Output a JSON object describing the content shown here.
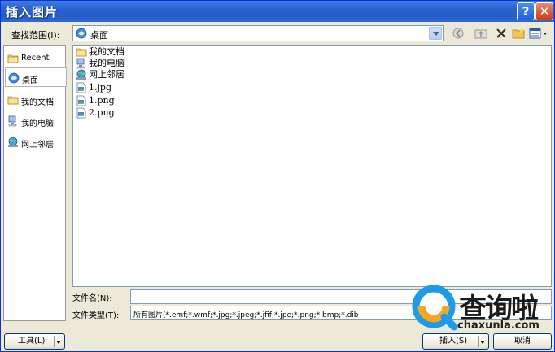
{
  "window": {
    "title": "插入图片"
  },
  "titlebar": {
    "help_glyph": "?",
    "close_glyph": "✕"
  },
  "lookin": {
    "label": "查找范围(I):",
    "value": "桌面"
  },
  "places": [
    {
      "label": "Recent",
      "icon": "folder-icon"
    },
    {
      "label": "桌面",
      "icon": "desktop-icon",
      "selected": true
    },
    {
      "label": "我的文档",
      "icon": "folder-icon"
    },
    {
      "label": "我的电脑",
      "icon": "computer-icon"
    },
    {
      "label": "网上邻居",
      "icon": "network-icon"
    }
  ],
  "files": [
    {
      "name": "我的文档",
      "icon": "folder-icon"
    },
    {
      "name": "我的电脑",
      "icon": "computer-icon"
    },
    {
      "name": "网上邻居",
      "icon": "network-icon"
    },
    {
      "name": "1.jpg",
      "icon": "image-file-icon"
    },
    {
      "name": "1.png",
      "icon": "image-file-icon"
    },
    {
      "name": "2.png",
      "icon": "image-file-icon"
    }
  ],
  "filename": {
    "label": "文件名(N):",
    "value": ""
  },
  "filetype": {
    "label": "文件类型(T):",
    "value": "所有图片(*.emf;*.wmf;*.jpg;*.jpeg;*.jfif;*.jpe;*.png;*.bmp;*.dib"
  },
  "buttons": {
    "tools": "工具(L)",
    "insert": "插入(S)",
    "cancel": "取消"
  },
  "watermark": {
    "brand": "查询啦",
    "domain": "chaxunla.com"
  },
  "colors": {
    "title_bar": "#245bc8",
    "window_bg": "#ece9d8",
    "close_red": "#c7401e",
    "accent_orange": "#f5a623"
  }
}
